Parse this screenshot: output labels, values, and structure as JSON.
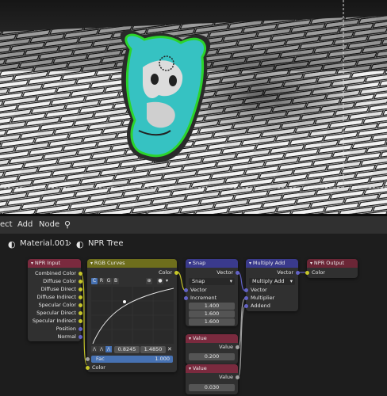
{
  "menu": {
    "select": "ect",
    "add": "Add",
    "node": "Node"
  },
  "breadcrumb": {
    "material": "Material.001",
    "separator": "›",
    "tree": "NPR Tree"
  },
  "nodes": {
    "npr_input": {
      "title": "NPR Input",
      "outputs": [
        "Combined Color",
        "Diffuse Color",
        "Diffuse Direct",
        "Diffuse Indirect",
        "Specular Color",
        "Specular Direct",
        "Specular Indirect",
        "Position",
        "Normal"
      ]
    },
    "rgb_curves": {
      "title": "RGB Curves",
      "out_color": "Color",
      "channels": [
        "C",
        "R",
        "G",
        "B"
      ],
      "val1": "0.8245",
      "val2": "1.4850",
      "fac_label": "Fac",
      "fac_value": "1.000",
      "in_color": "Color"
    },
    "snap": {
      "title": "Snap",
      "out": "Vector",
      "mode": "Snap",
      "in_vector": "Vector",
      "in_increment": "Increment",
      "vals": [
        "1.400",
        "1.600",
        "1.600"
      ]
    },
    "multiply_add": {
      "title": "Multiply Add",
      "out": "Vector",
      "mode": "Multiply Add",
      "inputs": [
        "Vector",
        "Multiplier",
        "Addend"
      ]
    },
    "npr_output": {
      "title": "NPR Output",
      "in": "Color"
    },
    "value1": {
      "title": "Value",
      "out": "Value",
      "value": "0.200"
    },
    "value2": {
      "title": "Value",
      "out": "Value",
      "value": "0.030"
    }
  },
  "colors": {
    "input_header": "#7a2a3e",
    "curves_header": "#6e6e1c",
    "vector_header": "#3a3a8c",
    "value_header": "#7a2a3e",
    "output_header": "#6b2636",
    "fac_bar": "#4772b3"
  }
}
